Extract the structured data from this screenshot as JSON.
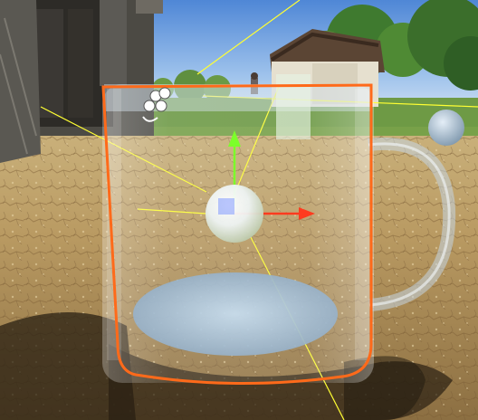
{
  "viewport": {
    "label": "",
    "selected_object_outline": "#ff6a1a",
    "gizmo_colors": {
      "x_axis": "#ff3b1f",
      "y_axis": "#7cff2a",
      "z_axis": "#2a5cff",
      "center": "#e9f3ff",
      "light_ray": "#ffff33"
    },
    "icons": [
      "light-probe-icon",
      "move-tool-gizmo",
      "reflection-probe-sphere"
    ]
  }
}
